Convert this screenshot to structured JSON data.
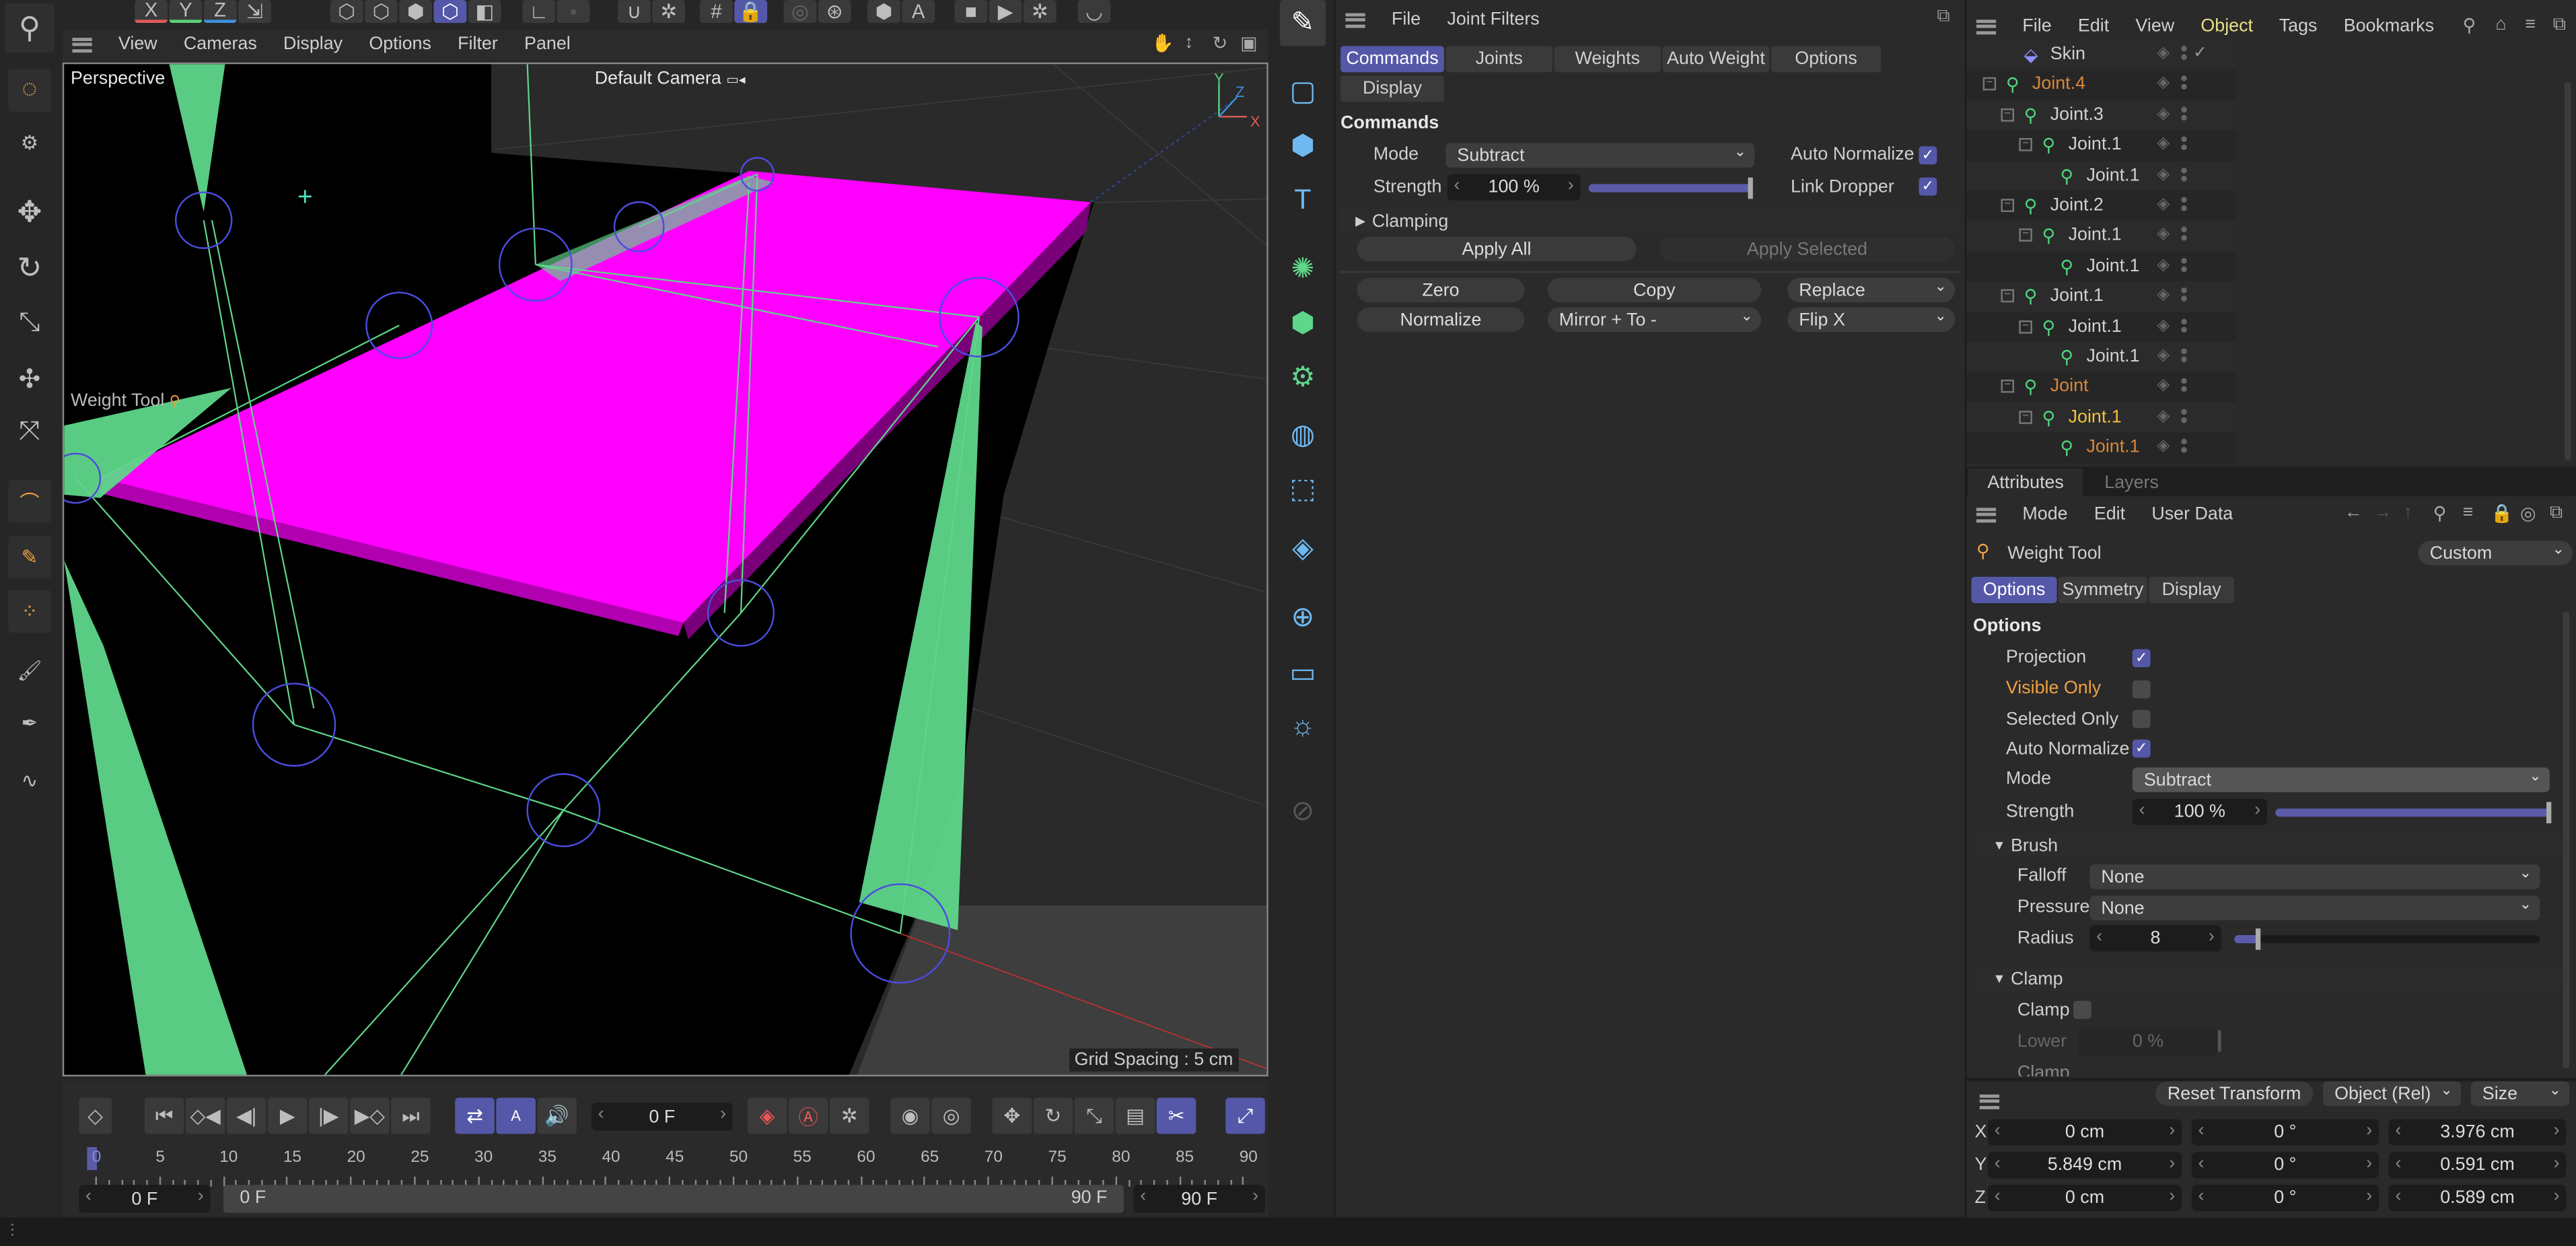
{
  "top_toolbar": {
    "icons": [
      "coordinate-x-icon",
      "coordinate-y-icon",
      "coordinate-z-icon",
      "coordinate-system-icon",
      "points-mode-icon",
      "edges-mode-icon",
      "polygons-mode-icon",
      "model-mode-icon",
      "uv-mode-icon",
      "axis-icon",
      "texture-icon",
      "magnet-icon",
      "snap-settings-icon",
      "grid-icon",
      "lock-workplane-icon",
      "render-region-icon",
      "render-view-icon",
      "render-icon",
      "ai-icon",
      "render-queue-icon",
      "render-picture-viewer-icon",
      "render-settings-icon",
      "view-icon"
    ],
    "axis_labels": [
      "X",
      "Y",
      "Z"
    ],
    "axis_colors": [
      "#e05a5a",
      "#59d27a",
      "#3f8fe0"
    ]
  },
  "left_toolbar": {
    "icons": [
      "search-icon",
      "live-selection-icon",
      "select-options-icon",
      "move-icon",
      "rotate-icon",
      "scale-icon",
      "transform-icon",
      "multi-transform-icon",
      "joint-tool-icon",
      "weight-tool-icon",
      "paint-weights-icon",
      "brush-icon",
      "pen-icon",
      "sketch-icon"
    ]
  },
  "viewport": {
    "menu": [
      "View",
      "Cameras",
      "Display",
      "Options",
      "Filter",
      "Panel"
    ],
    "view_name": "Perspective",
    "camera": "Default Camera",
    "tool_label": "Weight Tool",
    "grid_spacing": "Grid Spacing : 5 cm",
    "axis": {
      "x": "X",
      "y": "Y",
      "z": "Z"
    },
    "colors": {
      "mesh_top": "#ff00ff",
      "bones": "#5fd68a",
      "joint_circles": "#4c4ce0"
    }
  },
  "mid_toolbar": {
    "icons": [
      "spline-pen-icon",
      "rectangle-icon",
      "cube-icon",
      "text-icon",
      "generator-icon",
      "array-icon",
      "gear-icon",
      "deformer-icon",
      "field-icon",
      "mograph-icon",
      "globe-icon",
      "camera-icon",
      "light-icon",
      "disabled-tool-icon"
    ]
  },
  "weight_manager": {
    "menu": [
      "File",
      "Joint Filters"
    ],
    "tabs": [
      "Commands",
      "Joints",
      "Weights",
      "Auto Weight",
      "Options",
      "Display"
    ],
    "active_tab": "Commands",
    "section": "Commands",
    "mode_label": "Mode",
    "mode_value": "Subtract",
    "auto_normalize_label": "Auto Normalize",
    "auto_normalize": true,
    "strength_label": "Strength",
    "strength_value": "100 %",
    "strength_fraction": 1.0,
    "link_dropper_label": "Link Dropper",
    "link_dropper": true,
    "clamping_label": "Clamping",
    "apply_all": "Apply All",
    "apply_selected": "Apply Selected",
    "zero": "Zero",
    "copy": "Copy",
    "replace": "Replace",
    "normalize": "Normalize",
    "mirror": "Mirror + To -",
    "flip": "Flip X"
  },
  "object_manager": {
    "menu": [
      "File",
      "Edit",
      "View",
      "Object",
      "Tags",
      "Bookmarks"
    ],
    "active_menu": "Object",
    "rows": [
      {
        "name": "Skin",
        "level": 1,
        "type": "skin",
        "color": "#d0d0d0",
        "box": false,
        "check": true
      },
      {
        "name": "Joint.4",
        "level": 0,
        "type": "joint",
        "color": "#d8873a",
        "box": true
      },
      {
        "name": "Joint.3",
        "level": 1,
        "type": "joint",
        "color": "#d0d0d0",
        "box": true
      },
      {
        "name": "Joint.1",
        "level": 2,
        "type": "joint",
        "color": "#d0d0d0",
        "box": true
      },
      {
        "name": "Joint.1",
        "level": 3,
        "type": "joint",
        "color": "#d0d0d0",
        "box": false
      },
      {
        "name": "Joint.2",
        "level": 1,
        "type": "joint",
        "color": "#d0d0d0",
        "box": true
      },
      {
        "name": "Joint.1",
        "level": 2,
        "type": "joint",
        "color": "#d0d0d0",
        "box": true
      },
      {
        "name": "Joint.1",
        "level": 3,
        "type": "joint",
        "color": "#d0d0d0",
        "box": false
      },
      {
        "name": "Joint.1",
        "level": 1,
        "type": "joint",
        "color": "#d0d0d0",
        "box": true
      },
      {
        "name": "Joint.1",
        "level": 2,
        "type": "joint",
        "color": "#d0d0d0",
        "box": true
      },
      {
        "name": "Joint.1",
        "level": 3,
        "type": "joint",
        "color": "#d0d0d0",
        "box": false
      },
      {
        "name": "Joint",
        "level": 1,
        "type": "joint",
        "color": "#d8873a",
        "box": true
      },
      {
        "name": "Joint.1",
        "level": 2,
        "type": "joint",
        "color": "#f2c23a",
        "box": true
      },
      {
        "name": "Joint.1",
        "level": 3,
        "type": "joint",
        "color": "#d8873a",
        "box": false
      }
    ]
  },
  "attributes": {
    "tabs": [
      "Attributes",
      "Layers"
    ],
    "menu": [
      "Mode",
      "Edit",
      "User Data"
    ],
    "tool_name": "Weight Tool",
    "preset": "Custom",
    "subtabs": [
      "Options",
      "Symmetry",
      "Display"
    ],
    "section": "Options",
    "projection_label": "Projection",
    "projection": true,
    "visible_only_label": "Visible Only",
    "visible_only": false,
    "selected_only_label": "Selected Only",
    "selected_only": false,
    "auto_normalize_label": "Auto Normalize",
    "auto_normalize": true,
    "mode_label": "Mode",
    "mode_value": "Subtract",
    "strength_label": "Strength",
    "strength_value": "100 %",
    "strength_fraction": 1.0,
    "brush_section": "Brush",
    "falloff_label": "Falloff",
    "falloff_value": "None",
    "pressure_label": "Pressure",
    "pressure_value": "None",
    "radius_label": "Radius",
    "radius_value": "8",
    "radius_fraction": 0.08,
    "clamp_section": "Clamp",
    "clamp_label": "Clamp",
    "clamp": false,
    "lower_label": "Lower",
    "lower_value": "0 %",
    "clamp2_label": "Clamp"
  },
  "coordinates": {
    "reset": "Reset Transform",
    "space": "Object (Rel)",
    "mode": "Size",
    "rows": [
      {
        "axis": "X",
        "pos": "0 cm",
        "rot": "0 °",
        "size": "3.976 cm"
      },
      {
        "axis": "Y",
        "pos": "5.849 cm",
        "rot": "0 °",
        "size": "0.591 cm"
      },
      {
        "axis": "Z",
        "pos": "0 cm",
        "rot": "0 °",
        "size": "0.589 cm"
      }
    ]
  },
  "timeline": {
    "current_frame": "0 F",
    "ticks": [
      "0",
      "5",
      "10",
      "15",
      "20",
      "25",
      "30",
      "35",
      "40",
      "45",
      "50",
      "55",
      "60",
      "65",
      "70",
      "75",
      "80",
      "85",
      "90"
    ],
    "start": "0 F",
    "range_start": "0 F",
    "range_end": "90 F",
    "end": "90 F",
    "icons": [
      "keyframe-icon",
      "go-to-start-icon",
      "previous-key-icon",
      "previous-frame-icon",
      "play-icon",
      "next-frame-icon",
      "next-key-icon",
      "go-to-end-icon",
      "loop-icon",
      "playback-mode-icon",
      "sound-icon",
      "record-icon",
      "autokey-icon",
      "key-settings-icon",
      "motion-icon",
      "keyframe-selection-icon",
      "position-key-icon",
      "rotation-key-icon",
      "scale-key-icon",
      "param-key-icon",
      "pla-key-icon",
      "timeline-axis-icon"
    ]
  }
}
